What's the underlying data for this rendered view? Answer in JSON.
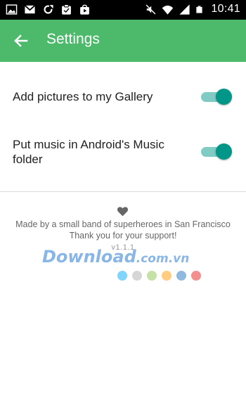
{
  "status_bar": {
    "time": "10:41",
    "left_icons": [
      "image-icon",
      "gmail-icon",
      "sync-icon",
      "clipboard-icon",
      "store-icon"
    ],
    "right_icons": [
      "mute-icon",
      "wifi-icon",
      "signal-icon",
      "battery-icon"
    ]
  },
  "app_bar": {
    "title": "Settings",
    "back_icon": "arrow-left-icon",
    "color": "#4cba6a"
  },
  "settings": [
    {
      "label": "Add pictures to my Gallery",
      "enabled": true
    },
    {
      "label": "Put music in Android's Music folder",
      "enabled": true
    }
  ],
  "toggle_colors": {
    "track": "#80cbc4",
    "thumb": "#009688"
  },
  "footer": {
    "heart_icon": "heart-icon",
    "line1": "Made by a small band of superheroes in San Francisco",
    "line2": "Thank you for your support!",
    "version": "v1.1.1",
    "dot_colors": [
      "#81d4fa",
      "#d6d6d6",
      "#c5e1a5",
      "#ffcc80",
      "#90b9e0",
      "#f48f8f"
    ]
  },
  "watermark": {
    "brand": "Download",
    "domain": ".com.vn"
  }
}
